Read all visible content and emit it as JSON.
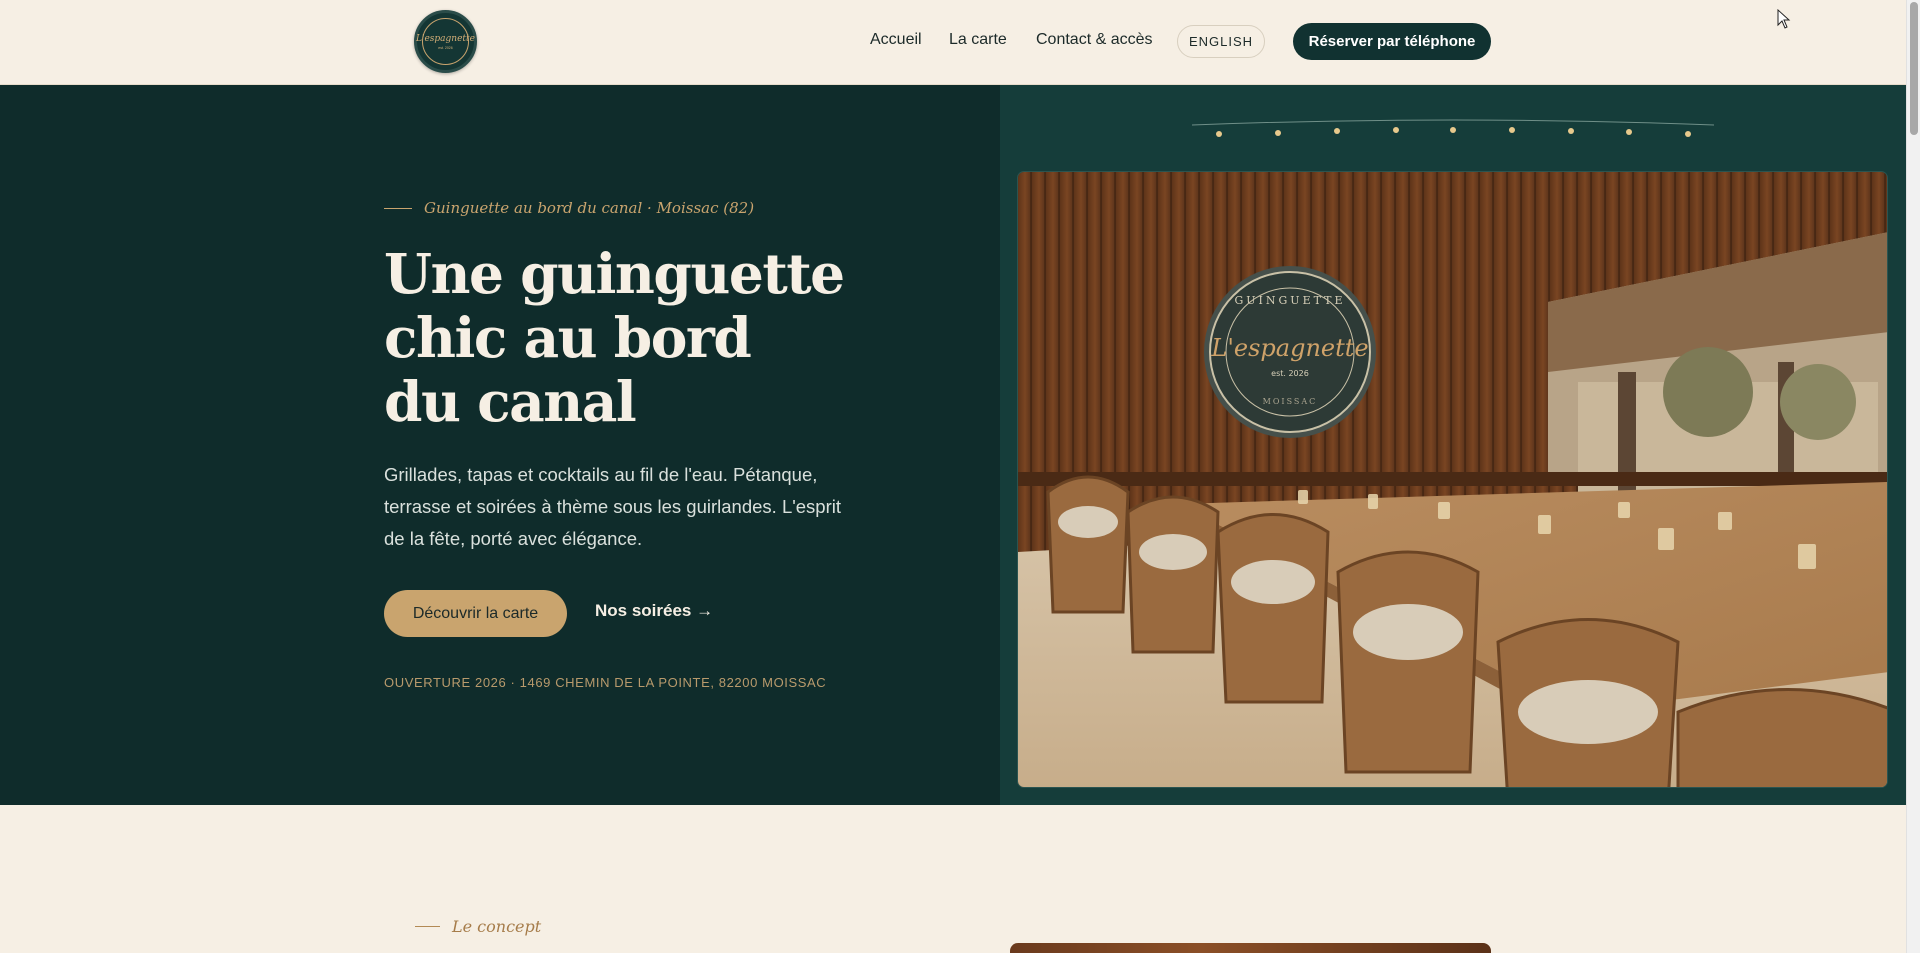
{
  "header": {
    "logo": {
      "text": "L'espagnette",
      "est": "est. 2026"
    },
    "nav": [
      "Accueil",
      "La carte",
      "Contact & accès"
    ],
    "lang_label": "ENGLISH",
    "reserve_label": "Réserver par téléphone"
  },
  "hero": {
    "eyebrow": "Guinguette au bord du canal · Moissac (82)",
    "title_lines": [
      "Une guinguette",
      "chic au bord",
      "du canal"
    ],
    "description": "Grillades, tapas et cocktails au fil de l'eau. Pétanque, terrasse et soirées à thème sous les guirlandes. L'esprit de la fête, porté avec élégance.",
    "primary_cta": "Découvrir la carte",
    "secondary_cta": "Nos soirées →",
    "address": "OUVERTURE 2026 · 1469 CHEMIN DE LA POINTE, 82200 MOISSAC"
  },
  "photo": {
    "sign_top": "GUINGUETTE",
    "sign_name": "L'espagnette",
    "sign_est": "est. 2026",
    "sign_bottom": "MOISSAC"
  },
  "concept": {
    "eyebrow": "Le concept"
  },
  "colors": {
    "deep_green": "#0f2c2b",
    "accent_green": "#153d3a",
    "cream": "#f6efe4",
    "gold": "#c9a46e"
  },
  "icons": {
    "cursor": "mouse-pointer-icon",
    "garland": "string-lights-icon"
  }
}
